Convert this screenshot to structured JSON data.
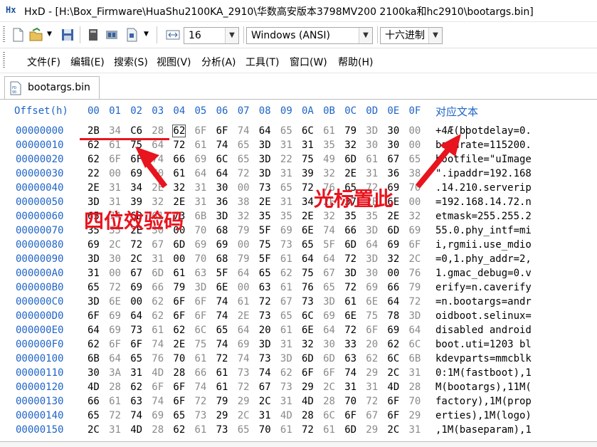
{
  "window": {
    "title": "HxD - [H:\\Box_Firmware\\HuaShu2100KA_2910\\华数高安版本3798MV200 2100ka和hc2910\\bootargs.bin]"
  },
  "toolbar": {
    "bytes_per_row": "16",
    "charset": "Windows (ANSI)",
    "offset_base": "十六进制"
  },
  "menu": {
    "items": [
      "文件(F)",
      "编辑(E)",
      "搜索(S)",
      "视图(V)",
      "分析(A)",
      "工具(T)",
      "窗口(W)",
      "帮助(H)"
    ]
  },
  "tab": {
    "label": "bootargs.bin"
  },
  "editor": {
    "offset_header": "Offset(h)",
    "columns": [
      "00",
      "01",
      "02",
      "03",
      "04",
      "05",
      "06",
      "07",
      "08",
      "09",
      "0A",
      "0B",
      "0C",
      "0D",
      "0E",
      "0F"
    ],
    "text_header": "对应文本",
    "rows": [
      {
        "offset": "00000000",
        "bytes": [
          "2B",
          "34",
          "C6",
          "28",
          "62",
          "6F",
          "6F",
          "74",
          "64",
          "65",
          "6C",
          "61",
          "79",
          "3D",
          "30",
          "00"
        ],
        "text": "+4Æ(bootdelay=0."
      },
      {
        "offset": "00000010",
        "bytes": [
          "62",
          "61",
          "75",
          "64",
          "72",
          "61",
          "74",
          "65",
          "3D",
          "31",
          "31",
          "35",
          "32",
          "30",
          "30",
          "00"
        ],
        "text": "baudrate=115200."
      },
      {
        "offset": "00000020",
        "bytes": [
          "62",
          "6F",
          "6F",
          "74",
          "66",
          "69",
          "6C",
          "65",
          "3D",
          "22",
          "75",
          "49",
          "6D",
          "61",
          "67",
          "65"
        ],
        "text": "bootfile=\"uImage"
      },
      {
        "offset": "00000030",
        "bytes": [
          "22",
          "00",
          "69",
          "70",
          "61",
          "64",
          "64",
          "72",
          "3D",
          "31",
          "39",
          "32",
          "2E",
          "31",
          "36",
          "38"
        ],
        "text": "\".ipaddr=192.168"
      },
      {
        "offset": "00000040",
        "bytes": [
          "2E",
          "31",
          "34",
          "2E",
          "32",
          "31",
          "30",
          "00",
          "73",
          "65",
          "72",
          "76",
          "65",
          "72",
          "69",
          "70"
        ],
        "text": ".14.210.serverip"
      },
      {
        "offset": "00000050",
        "bytes": [
          "3D",
          "31",
          "39",
          "32",
          "2E",
          "31",
          "36",
          "38",
          "2E",
          "31",
          "34",
          "2E",
          "37",
          "2E",
          "6E",
          "00"
        ],
        "text": "=192.168.14.72.n"
      },
      {
        "offset": "00000060",
        "bytes": [
          "65",
          "74",
          "6D",
          "61",
          "73",
          "6B",
          "3D",
          "32",
          "35",
          "35",
          "2E",
          "32",
          "35",
          "35",
          "2E",
          "32"
        ],
        "text": "etmask=255.255.2"
      },
      {
        "offset": "00000070",
        "bytes": [
          "35",
          "35",
          "2E",
          "30",
          "00",
          "70",
          "68",
          "79",
          "5F",
          "69",
          "6E",
          "74",
          "66",
          "3D",
          "6D",
          "69"
        ],
        "text": "55.0.phy_intf=mi"
      },
      {
        "offset": "00000080",
        "bytes": [
          "69",
          "2C",
          "72",
          "67",
          "6D",
          "69",
          "69",
          "00",
          "75",
          "73",
          "65",
          "5F",
          "6D",
          "64",
          "69",
          "6F"
        ],
        "text": "i,rgmii.use_mdio"
      },
      {
        "offset": "00000090",
        "bytes": [
          "3D",
          "30",
          "2C",
          "31",
          "00",
          "70",
          "68",
          "79",
          "5F",
          "61",
          "64",
          "64",
          "72",
          "3D",
          "32",
          "2C"
        ],
        "text": "=0,1.phy_addr=2,"
      },
      {
        "offset": "000000A0",
        "bytes": [
          "31",
          "00",
          "67",
          "6D",
          "61",
          "63",
          "5F",
          "64",
          "65",
          "62",
          "75",
          "67",
          "3D",
          "30",
          "00",
          "76"
        ],
        "text": "1.gmac_debug=0.v"
      },
      {
        "offset": "000000B0",
        "bytes": [
          "65",
          "72",
          "69",
          "66",
          "79",
          "3D",
          "6E",
          "00",
          "63",
          "61",
          "76",
          "65",
          "72",
          "69",
          "66",
          "79"
        ],
        "text": "erify=n.caverify"
      },
      {
        "offset": "000000C0",
        "bytes": [
          "3D",
          "6E",
          "00",
          "62",
          "6F",
          "6F",
          "74",
          "61",
          "72",
          "67",
          "73",
          "3D",
          "61",
          "6E",
          "64",
          "72"
        ],
        "text": "=n.bootargs=andr"
      },
      {
        "offset": "000000D0",
        "bytes": [
          "6F",
          "69",
          "64",
          "62",
          "6F",
          "6F",
          "74",
          "2E",
          "73",
          "65",
          "6C",
          "69",
          "6E",
          "75",
          "78",
          "3D"
        ],
        "text": "oidboot.selinux="
      },
      {
        "offset": "000000E0",
        "bytes": [
          "64",
          "69",
          "73",
          "61",
          "62",
          "6C",
          "65",
          "64",
          "20",
          "61",
          "6E",
          "64",
          "72",
          "6F",
          "69",
          "64"
        ],
        "text": "disabled android"
      },
      {
        "offset": "000000F0",
        "bytes": [
          "62",
          "6F",
          "6F",
          "74",
          "2E",
          "75",
          "74",
          "69",
          "3D",
          "31",
          "32",
          "30",
          "33",
          "20",
          "62",
          "6C"
        ],
        "text": "boot.uti=1203 bl"
      },
      {
        "offset": "00000100",
        "bytes": [
          "6B",
          "64",
          "65",
          "76",
          "70",
          "61",
          "72",
          "74",
          "73",
          "3D",
          "6D",
          "6D",
          "63",
          "62",
          "6C",
          "6B"
        ],
        "text": "kdevparts=mmcblk"
      },
      {
        "offset": "00000110",
        "bytes": [
          "30",
          "3A",
          "31",
          "4D",
          "28",
          "66",
          "61",
          "73",
          "74",
          "62",
          "6F",
          "6F",
          "74",
          "29",
          "2C",
          "31"
        ],
        "text": "0:1M(fastboot),1"
      },
      {
        "offset": "00000120",
        "bytes": [
          "4D",
          "28",
          "62",
          "6F",
          "6F",
          "74",
          "61",
          "72",
          "67",
          "73",
          "29",
          "2C",
          "31",
          "31",
          "4D",
          "28"
        ],
        "text": "M(bootargs),11M("
      },
      {
        "offset": "00000130",
        "bytes": [
          "66",
          "61",
          "63",
          "74",
          "6F",
          "72",
          "79",
          "29",
          "2C",
          "31",
          "4D",
          "28",
          "70",
          "72",
          "6F",
          "70"
        ],
        "text": "factory),1M(prop"
      },
      {
        "offset": "00000140",
        "bytes": [
          "65",
          "72",
          "74",
          "69",
          "65",
          "73",
          "29",
          "2C",
          "31",
          "4D",
          "28",
          "6C",
          "6F",
          "67",
          "6F",
          "29"
        ],
        "text": "erties),1M(logo)"
      },
      {
        "offset": "00000150",
        "bytes": [
          "2C",
          "31",
          "4D",
          "28",
          "62",
          "61",
          "73",
          "65",
          "70",
          "61",
          "72",
          "61",
          "6D",
          "29",
          "2C",
          "31"
        ],
        "text": ",1M(baseparam),1"
      }
    ]
  },
  "annotations": {
    "checksum_label": "四位效验码",
    "cursor_label": "光标置此"
  },
  "colors": {
    "accent_blue": "#1e64c8",
    "annotation_red": "#e8141e",
    "muted_hex": "#8a8a8a"
  }
}
